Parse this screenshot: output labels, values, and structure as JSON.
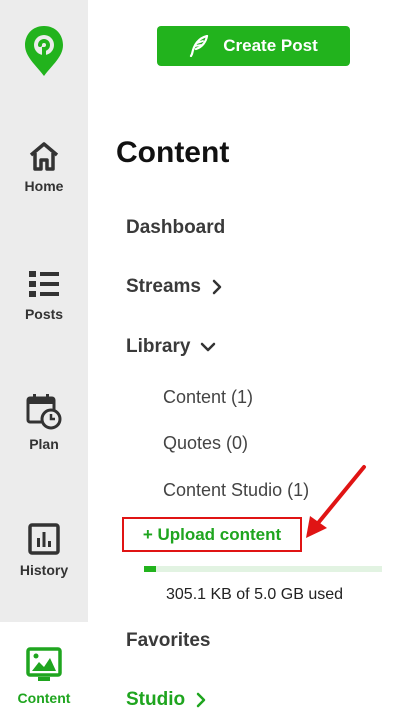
{
  "sidebar": {
    "items": [
      {
        "label": "Home",
        "icon": "home-icon"
      },
      {
        "label": "Posts",
        "icon": "list-icon"
      },
      {
        "label": "Plan",
        "icon": "calendar-clock-icon"
      },
      {
        "label": "History",
        "icon": "bar-chart-icon"
      },
      {
        "label": "Content",
        "icon": "image-icon",
        "active": true
      }
    ]
  },
  "header": {
    "create_post_label": "Create Post"
  },
  "main": {
    "title": "Content",
    "nav": {
      "dashboard": "Dashboard",
      "streams": "Streams",
      "library": "Library",
      "library_items": [
        "Content (1)",
        "Quotes (0)",
        "Content Studio (1)"
      ],
      "upload": "+ Upload content",
      "storage_text": "305.1 KB of 5.0 GB used",
      "storage_fraction": 0.05,
      "favorites": "Favorites",
      "studio": "Studio"
    }
  },
  "colors": {
    "accent_green": "#22b31d",
    "rail_bg": "#ececec",
    "highlight_red": "#e01414"
  }
}
